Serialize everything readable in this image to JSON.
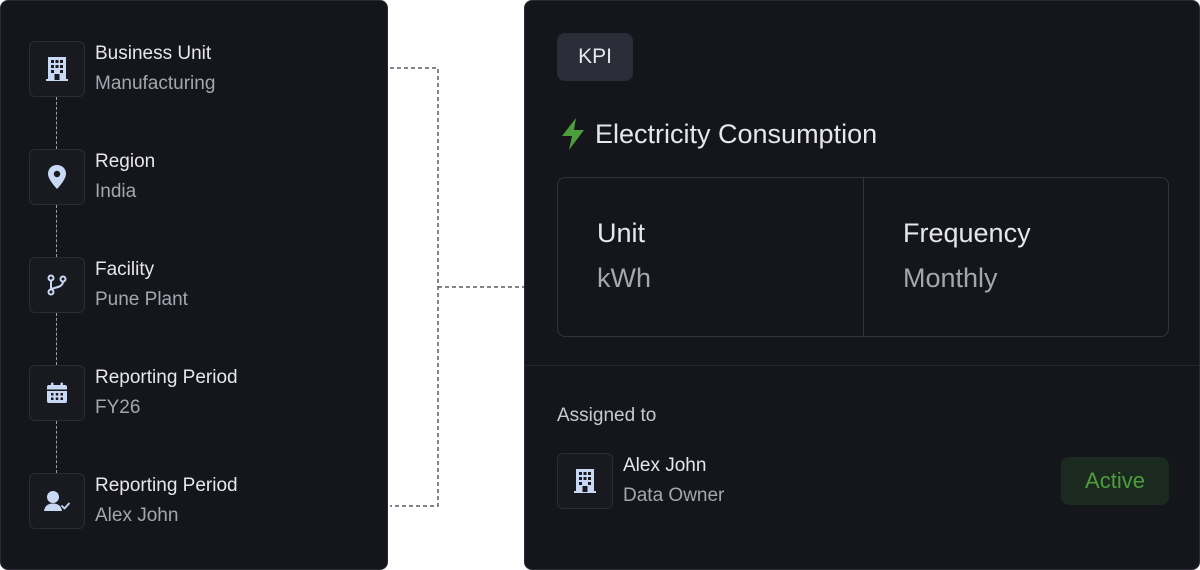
{
  "hierarchy": {
    "steps": [
      {
        "label": "Business Unit",
        "value": "Manufacturing",
        "icon": "building-icon"
      },
      {
        "label": "Region",
        "value": "India",
        "icon": "location-pin-icon"
      },
      {
        "label": "Facility",
        "value": "Pune Plant",
        "icon": "git-branch-icon"
      },
      {
        "label": "Reporting Period",
        "value": "FY26",
        "icon": "calendar-icon"
      },
      {
        "label": "Reporting Period",
        "value": "Alex John",
        "icon": "user-check-icon"
      }
    ]
  },
  "kpi": {
    "badge": "KPI",
    "title": "Electricity Consumption",
    "title_icon": "lightning-icon",
    "unit_label": "Unit",
    "unit_value": "kWh",
    "frequency_label": "Frequency",
    "frequency_value": "Monthly"
  },
  "assignment": {
    "heading": "Assigned to",
    "name": "Alex John",
    "role": "Data Owner",
    "icon": "building-icon",
    "status": "Active"
  },
  "colors": {
    "panel_bg": "#15151c",
    "accent_green": "#4c9d3c",
    "icon_blue": "#c9d8f5"
  }
}
